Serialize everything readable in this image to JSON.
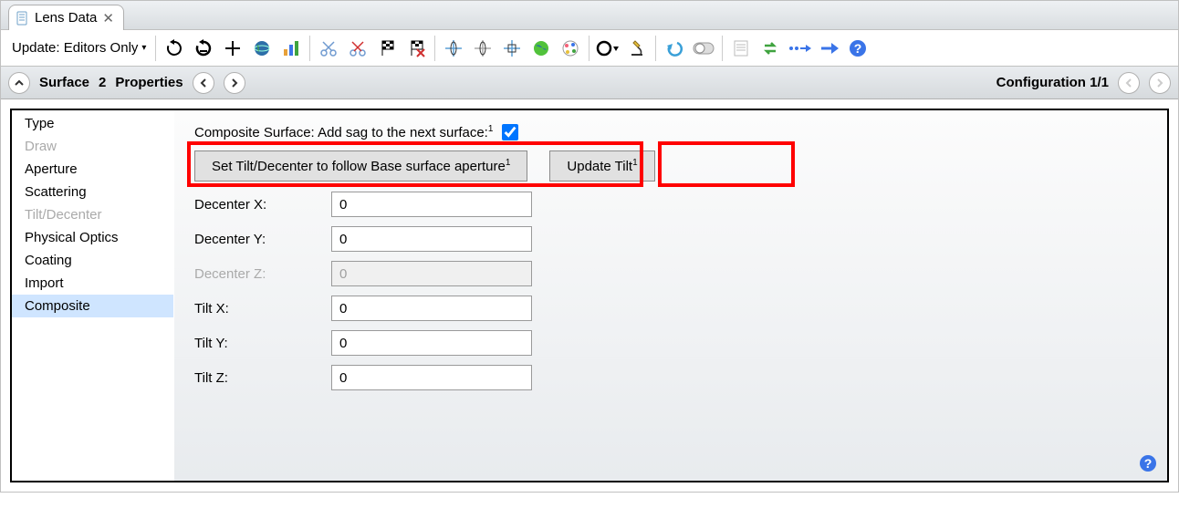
{
  "tab": {
    "title": "Lens Data"
  },
  "toolbar": {
    "update_label": "Update: Editors Only"
  },
  "propbar": {
    "surface_label": "Surface",
    "surface_number": "2",
    "properties_label": "Properties",
    "config_label": "Configuration 1/1"
  },
  "sidebar": {
    "items": [
      {
        "label": "Type",
        "disabled": false
      },
      {
        "label": "Draw",
        "disabled": true
      },
      {
        "label": "Aperture",
        "disabled": false
      },
      {
        "label": "Scattering",
        "disabled": false
      },
      {
        "label": "Tilt/Decenter",
        "disabled": true
      },
      {
        "label": "Physical Optics",
        "disabled": false
      },
      {
        "label": "Coating",
        "disabled": false
      },
      {
        "label": "Import",
        "disabled": false
      },
      {
        "label": "Composite",
        "disabled": false,
        "selected": true
      }
    ]
  },
  "panel": {
    "checkbox_label": "Composite Surface: Add sag to the next surface:",
    "checkbox_sup": "1",
    "checkbox_checked": true,
    "btn1_label": "Set Tilt/Decenter to follow Base surface aperture",
    "btn1_sup": "1",
    "btn2_label": "Update Tilt",
    "btn2_sup": "1",
    "fields": [
      {
        "label": "Decenter X:",
        "value": "0",
        "disabled": false
      },
      {
        "label": "Decenter Y:",
        "value": "0",
        "disabled": false
      },
      {
        "label": "Decenter Z:",
        "value": "0",
        "disabled": true
      },
      {
        "label": "Tilt X:",
        "value": "0",
        "disabled": false
      },
      {
        "label": "Tilt Y:",
        "value": "0",
        "disabled": false
      },
      {
        "label": "Tilt Z:",
        "value": "0",
        "disabled": false
      }
    ]
  }
}
